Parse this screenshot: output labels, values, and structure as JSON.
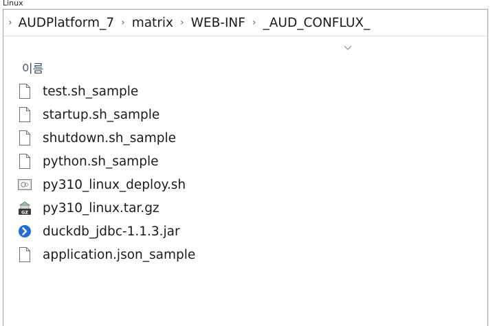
{
  "caption": "Linux",
  "breadcrumb": {
    "items": [
      "AUDPlatform_7",
      "matrix",
      "WEB-INF",
      "_AUD_CONFLUX_"
    ],
    "separator": "›"
  },
  "column_header": {
    "name_label": "이름"
  },
  "files": [
    {
      "name": "test.sh_sample",
      "icon": "blank-file-icon"
    },
    {
      "name": "startup.sh_sample",
      "icon": "blank-file-icon"
    },
    {
      "name": "shutdown.sh_sample",
      "icon": "blank-file-icon"
    },
    {
      "name": "python.sh_sample",
      "icon": "blank-file-icon"
    },
    {
      "name": "py310_linux_deploy.sh",
      "icon": "shell-script-icon"
    },
    {
      "name": "py310_linux.tar.gz",
      "icon": "gz-archive-icon"
    },
    {
      "name": "duckdb_jdbc-1.1.3.jar",
      "icon": "jar-icon"
    },
    {
      "name": "application.json_sample",
      "icon": "blank-file-icon"
    }
  ],
  "colors": {
    "header_text": "#3d4f6a",
    "jar_icon": "#1f6fd6",
    "border": "#9aa3ad"
  }
}
